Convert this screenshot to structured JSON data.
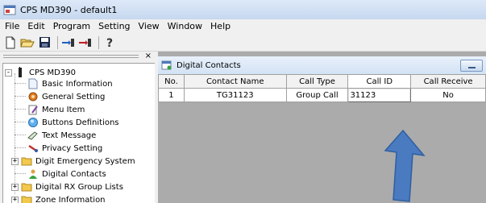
{
  "window": {
    "title": "CPS MD390 - default1",
    "icon": "app-window-icon"
  },
  "menubar": [
    {
      "label": "File"
    },
    {
      "label": "Edit"
    },
    {
      "label": "Program"
    },
    {
      "label": "Setting"
    },
    {
      "label": "View"
    },
    {
      "label": "Window"
    },
    {
      "label": "Help"
    }
  ],
  "toolbar": {
    "buttons": [
      "new-file-icon",
      "open-folder-icon",
      "save-disk-icon",
      "read-from-radio-icon",
      "write-to-radio-icon",
      "help-icon"
    ]
  },
  "tree": {
    "close_glyph": "×",
    "root": {
      "label": "CPS MD390",
      "expander": "-"
    },
    "items": [
      {
        "label": "Basic Information",
        "icon": "document-icon"
      },
      {
        "label": "General Setting",
        "icon": "gear-icon"
      },
      {
        "label": "Menu Item",
        "icon": "menu-edit-icon"
      },
      {
        "label": "Buttons Definitions",
        "icon": "button-icon"
      },
      {
        "label": "Text Message",
        "icon": "message-icon"
      },
      {
        "label": "Privacy Setting",
        "icon": "key-icon"
      },
      {
        "label": "Digit Emergency System",
        "icon": "folder-icon",
        "expander": "+"
      },
      {
        "label": "Digital Contacts",
        "icon": "contacts-icon"
      },
      {
        "label": "Digital RX Group Lists",
        "icon": "folder-icon",
        "expander": "+"
      },
      {
        "label": "Zone Information",
        "icon": "folder-icon",
        "expander": "+"
      }
    ]
  },
  "document": {
    "title": "Digital Contacts",
    "columns": [
      "No.",
      "Contact Name",
      "Call Type",
      "Call ID",
      "Call Receive"
    ],
    "rows": [
      {
        "no": "1",
        "name": "TG31123",
        "type": "Group Call",
        "id": "31123",
        "receive": "No"
      }
    ]
  },
  "colors": {
    "arrow_fill": "#4a7ac0",
    "arrow_stroke": "#2f5fa0",
    "mdi_background": "#ababab"
  }
}
